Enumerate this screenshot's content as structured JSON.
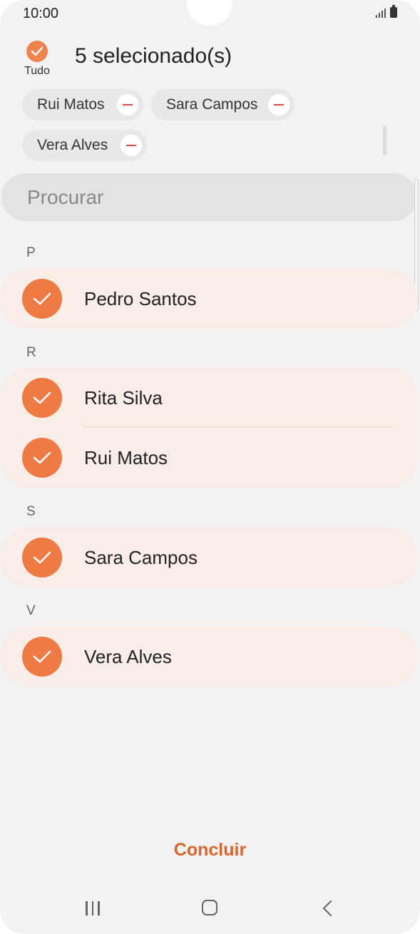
{
  "status_bar": {
    "time": "10:00"
  },
  "header": {
    "select_all_label": "Tudo",
    "selected_count_text": "5 selecionado(s)"
  },
  "chips": [
    {
      "label": "Rui Matos"
    },
    {
      "label": "Sara Campos"
    },
    {
      "label": "Vera Alves"
    }
  ],
  "search": {
    "placeholder": "Procurar"
  },
  "sections": [
    {
      "letter": "P",
      "contacts": [
        {
          "name": "Pedro Santos",
          "selected": true
        }
      ]
    },
    {
      "letter": "R",
      "contacts": [
        {
          "name": "Rita Silva",
          "selected": true
        },
        {
          "name": "Rui Matos",
          "selected": true
        }
      ]
    },
    {
      "letter": "S",
      "contacts": [
        {
          "name": "Sara Campos",
          "selected": true
        }
      ]
    },
    {
      "letter": "V",
      "contacts": [
        {
          "name": "Vera Alves",
          "selected": true
        }
      ]
    }
  ],
  "footer": {
    "done_label": "Concluir"
  },
  "colors": {
    "accent": "#ee7a44",
    "done_text": "#d9642c",
    "selected_row_bg": "#f9ede8",
    "remove_icon": "#e04a4a"
  },
  "icons": {
    "select_all": "check-icon",
    "chip_remove": "minus-circle-icon",
    "row_check": "check-icon",
    "nav": [
      "recent-apps-icon",
      "home-icon",
      "back-icon"
    ]
  }
}
